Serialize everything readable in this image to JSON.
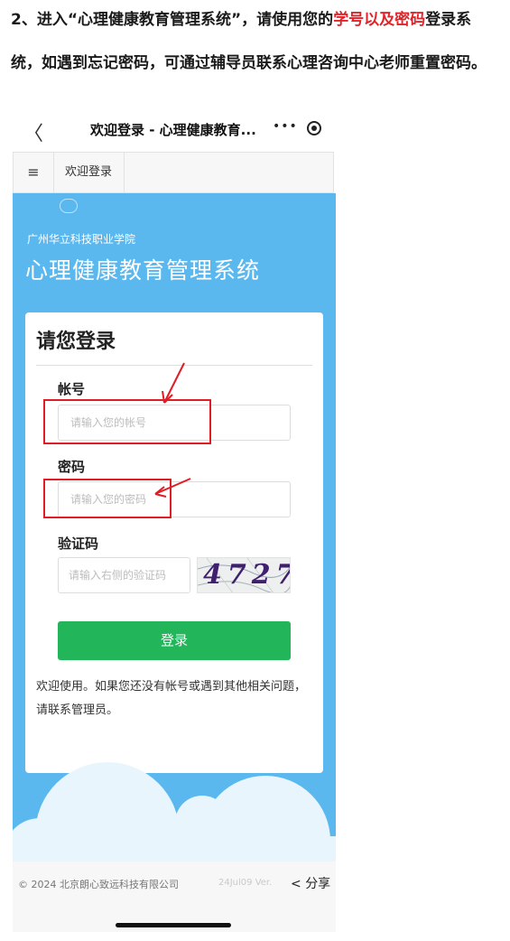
{
  "instruction": {
    "line1_pre": "2、进入“心理健康教育管理系统”，请使用您的",
    "line1_highlight": "学号以及密码",
    "line1_post": "登录系",
    "line2": "统，如遇到忘记密码，可通过辅导员联系心理咨询中心老师重置密码。"
  },
  "wechat": {
    "back_icon": "chevron-left-icon",
    "title": "欢迎登录 - 心理健康教育...",
    "more_label": "•••",
    "target_icon": "target-icon"
  },
  "nav": {
    "menu_icon": "≡",
    "tab_label": "欢迎登录"
  },
  "header": {
    "school": "广州华立科技职业学院",
    "system_title": "心理健康教育管理系统"
  },
  "login": {
    "title": "请您登录",
    "account_label": "帐号",
    "account_placeholder": "请输入您的帐号",
    "password_label": "密码",
    "password_placeholder": "请输入您的密码",
    "captcha_label": "验证码",
    "captcha_placeholder": "请输入右侧的验证码",
    "captcha_text": "4727",
    "login_button": "登录",
    "notice": "欢迎使用。如果您还没有帐号或遇到其他相关问题，请联系管理员。"
  },
  "footer": {
    "copyright": "© 2024 北京朗心致远科技有限公司",
    "version": "24Jul09 Ver.",
    "share_label": "分享"
  },
  "colors": {
    "highlight_red": "#e0242a",
    "header_blue": "#5bb8ef",
    "button_green": "#23b55a"
  }
}
